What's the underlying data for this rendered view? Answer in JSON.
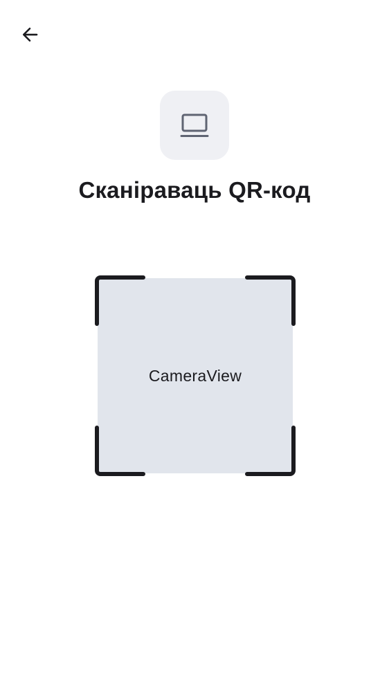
{
  "header": {
    "back_icon": "arrow-left-icon"
  },
  "hero": {
    "icon": "laptop-icon",
    "title": "Сканіраваць QR-код"
  },
  "scanner": {
    "camera_label": "CameraView"
  }
}
